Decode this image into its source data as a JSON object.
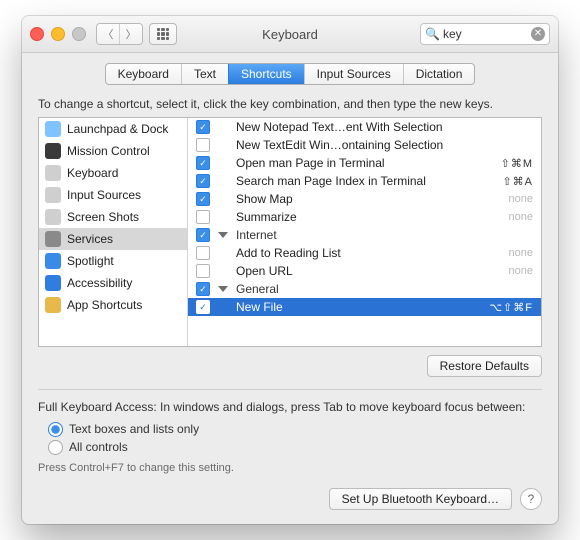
{
  "window": {
    "title": "Keyboard"
  },
  "search": {
    "placeholder": "Search",
    "value": "key"
  },
  "tabs": [
    {
      "label": "Keyboard",
      "selected": false
    },
    {
      "label": "Text",
      "selected": false
    },
    {
      "label": "Shortcuts",
      "selected": true
    },
    {
      "label": "Input Sources",
      "selected": false
    },
    {
      "label": "Dictation",
      "selected": false
    }
  ],
  "instruction": "To change a shortcut, select it, click the key combination, and then type the new keys.",
  "sidebar": {
    "items": [
      {
        "label": "Launchpad & Dock",
        "icon": "launchpad-icon",
        "color": "#7fc3ff"
      },
      {
        "label": "Mission Control",
        "icon": "mission-control-icon",
        "color": "#3a3a3a"
      },
      {
        "label": "Keyboard",
        "icon": "keyboard-icon",
        "color": "#cfcfcf"
      },
      {
        "label": "Input Sources",
        "icon": "input-sources-icon",
        "color": "#cfcfcf"
      },
      {
        "label": "Screen Shots",
        "icon": "screenshots-icon",
        "color": "#cfcfcf"
      },
      {
        "label": "Services",
        "icon": "services-icon",
        "color": "#8a8a8a",
        "selected": true
      },
      {
        "label": "Spotlight",
        "icon": "spotlight-icon",
        "color": "#3a8be8"
      },
      {
        "label": "Accessibility",
        "icon": "accessibility-icon",
        "color": "#2f7de0"
      },
      {
        "label": "App Shortcuts",
        "icon": "app-shortcuts-icon",
        "color": "#e7b94a"
      }
    ]
  },
  "shortcuts": [
    {
      "type": "item",
      "checked": true,
      "label": "New Notepad Text…ent With Selection",
      "shortcut": ""
    },
    {
      "type": "item",
      "checked": false,
      "label": "New TextEdit Win…ontaining Selection",
      "shortcut": ""
    },
    {
      "type": "item",
      "checked": true,
      "label": "Open man Page in Terminal",
      "shortcut": "⇧⌘M"
    },
    {
      "type": "item",
      "checked": true,
      "label": "Search man Page Index in Terminal",
      "shortcut": "⇧⌘A"
    },
    {
      "type": "item",
      "checked": true,
      "label": "Show Map",
      "shortcut": "none"
    },
    {
      "type": "item",
      "checked": false,
      "label": "Summarize",
      "shortcut": "none"
    },
    {
      "type": "group",
      "checked": true,
      "label": "Internet"
    },
    {
      "type": "item",
      "checked": false,
      "label": "Add to Reading List",
      "shortcut": "none"
    },
    {
      "type": "item",
      "checked": false,
      "label": "Open URL",
      "shortcut": "none"
    },
    {
      "type": "group",
      "checked": true,
      "label": "General"
    },
    {
      "type": "item",
      "checked": true,
      "label": "New File",
      "shortcut": "⌥⇧⌘F",
      "selected": true
    }
  ],
  "buttons": {
    "restore": "Restore Defaults",
    "bluetooth": "Set Up Bluetooth Keyboard…"
  },
  "fullKeyboard": {
    "label": "Full Keyboard Access: In windows and dialogs, press Tab to move keyboard focus between:",
    "options": [
      {
        "label": "Text boxes and lists only",
        "selected": true
      },
      {
        "label": "All controls",
        "selected": false
      }
    ],
    "hint": "Press Control+F7 to change this setting."
  }
}
